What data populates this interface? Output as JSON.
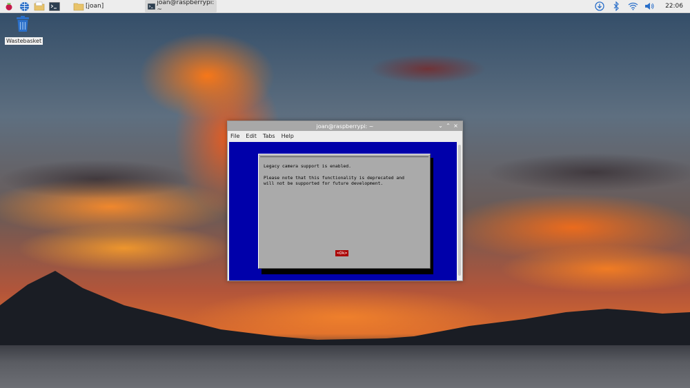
{
  "taskbar": {
    "launcher_icons": [
      "raspberry-menu-icon",
      "web-browser-icon",
      "file-manager-icon",
      "terminal-icon"
    ],
    "tasks": [
      {
        "label": "[joan]",
        "icon": "folder-icon"
      },
      {
        "label": "joan@raspberrypi: ~",
        "icon": "terminal-icon"
      }
    ],
    "tray_icons": [
      "update-icon",
      "bluetooth-icon",
      "wifi-icon",
      "volume-icon"
    ],
    "clock": "22:06"
  },
  "desktop": {
    "icons": [
      {
        "label": "Wastebasket",
        "icon": "trash-icon"
      }
    ]
  },
  "window": {
    "title": "joan@raspberrypi: ~",
    "menu": [
      "File",
      "Edit",
      "Tabs",
      "Help"
    ],
    "dialog": {
      "line1": "Legacy camera support is enabled.",
      "line2": "Please note that this functionality is deprecated and",
      "line3": "will not be supported for future development.",
      "ok_label": "<Ok>"
    }
  },
  "colors": {
    "terminal_bg": "#0000aa",
    "dialog_bg": "#aaaaaa",
    "ok_bg": "#aa0000"
  }
}
